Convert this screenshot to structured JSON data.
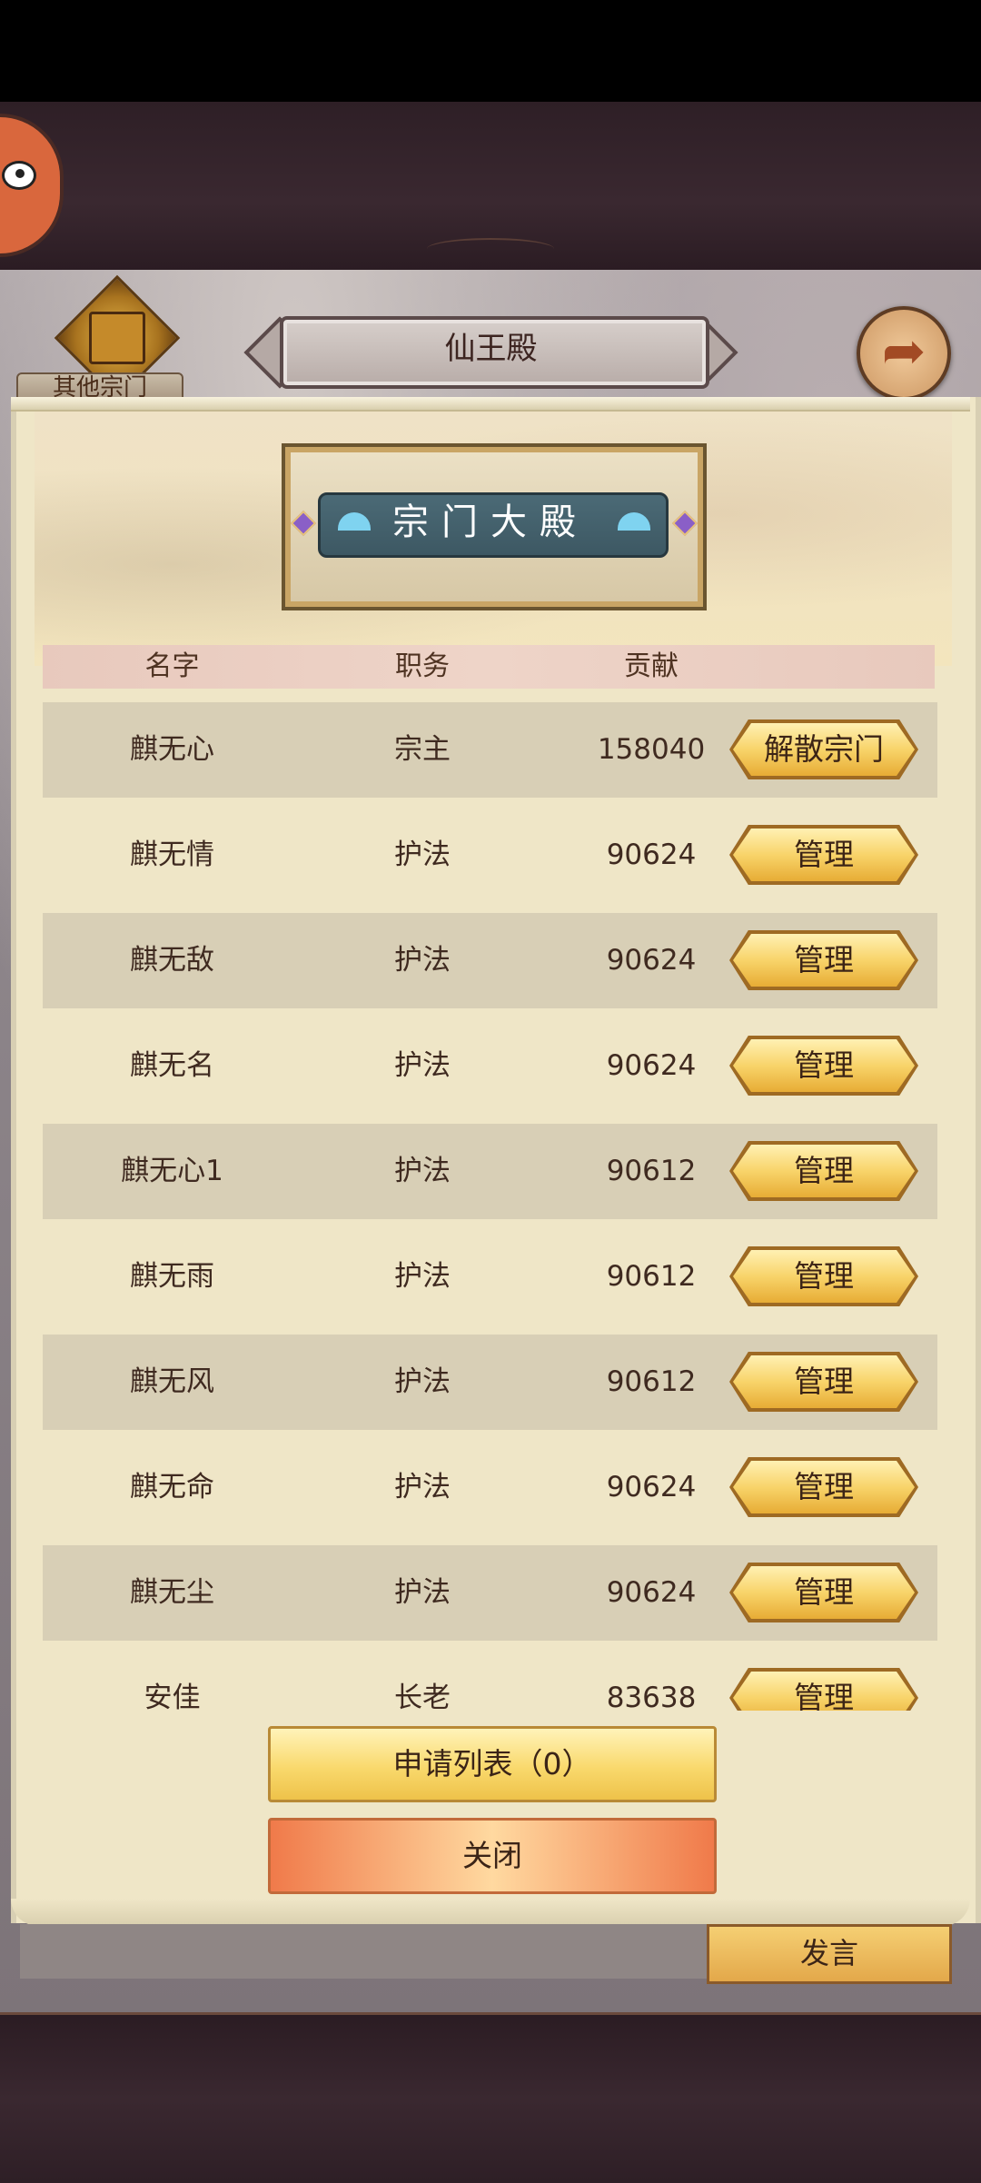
{
  "header": {
    "title": "仙王殿",
    "other_sects_label": "其他宗门",
    "back_icon": "back-arrow-icon"
  },
  "plaque": {
    "title": "宗门大殿"
  },
  "table": {
    "columns": {
      "name": "名字",
      "role": "职务",
      "contribution": "贡献"
    },
    "rows": [
      {
        "name": "麒无心",
        "role": "宗主",
        "contribution": "158040",
        "action": "解散宗门"
      },
      {
        "name": "麒无情",
        "role": "护法",
        "contribution": "90624",
        "action": "管理"
      },
      {
        "name": "麒无敌",
        "role": "护法",
        "contribution": "90624",
        "action": "管理"
      },
      {
        "name": "麒无名",
        "role": "护法",
        "contribution": "90624",
        "action": "管理"
      },
      {
        "name": "麒无心1",
        "role": "护法",
        "contribution": "90612",
        "action": "管理"
      },
      {
        "name": "麒无雨",
        "role": "护法",
        "contribution": "90612",
        "action": "管理"
      },
      {
        "name": "麒无风",
        "role": "护法",
        "contribution": "90612",
        "action": "管理"
      },
      {
        "name": "麒无命",
        "role": "护法",
        "contribution": "90624",
        "action": "管理"
      },
      {
        "name": "麒无尘",
        "role": "护法",
        "contribution": "90624",
        "action": "管理"
      },
      {
        "name": "安佳",
        "role": "长老",
        "contribution": "83638",
        "action": "管理"
      }
    ]
  },
  "footer": {
    "apply_list_label": "申请列表（0）",
    "close_label": "关闭",
    "speak_label": "发言"
  }
}
